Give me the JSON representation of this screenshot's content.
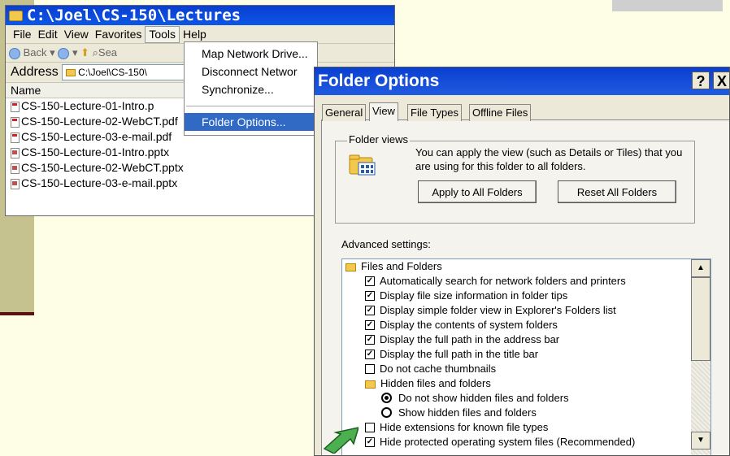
{
  "explorer": {
    "title": "C:\\Joel\\CS-150\\Lectures",
    "menu": [
      "File",
      "Edit",
      "View",
      "Favorites",
      "Tools",
      "Help"
    ],
    "toolbar": {
      "back": "Back",
      "search": "Sea"
    },
    "address_label": "Address",
    "address_value": "C:\\Joel\\CS-150\\",
    "column_name": "Name",
    "files": [
      {
        "name": "CS-150-Lecture-01-Intro.p",
        "type": "pdf"
      },
      {
        "name": "CS-150-Lecture-02-WebCT.pdf",
        "type": "pdf"
      },
      {
        "name": "CS-150-Lecture-03-e-mail.pdf",
        "type": "pdf"
      },
      {
        "name": "CS-150-Lecture-01-Intro.pptx",
        "type": "pptx"
      },
      {
        "name": "CS-150-Lecture-02-WebCT.pptx",
        "type": "pptx"
      },
      {
        "name": "CS-150-Lecture-03-e-mail.pptx",
        "type": "pptx"
      }
    ]
  },
  "tools_menu": {
    "items": [
      "Map Network Drive...",
      "Disconnect Networ",
      "Synchronize...",
      "Folder Options..."
    ]
  },
  "dialog": {
    "title": "Folder Options",
    "help": "?",
    "close": "X",
    "tabs": [
      "General",
      "View",
      "File Types",
      "Offline Files"
    ],
    "folder_views_label": "Folder views",
    "folder_views_text": "You can apply the view (such as Details or Tiles) that you are using for this folder to all folders.",
    "apply_button": "Apply to All Folders",
    "reset_button": "Reset All Folders",
    "advanced_label": "Advanced settings:",
    "settings": [
      {
        "kind": "folder",
        "label": "Files and Folders"
      },
      {
        "kind": "check",
        "checked": true,
        "label": "Automatically search for network folders and printers"
      },
      {
        "kind": "check",
        "checked": true,
        "label": "Display file size information in folder tips"
      },
      {
        "kind": "check",
        "checked": true,
        "label": "Display simple folder view in Explorer's Folders list"
      },
      {
        "kind": "check",
        "checked": true,
        "label": "Display the contents of system folders"
      },
      {
        "kind": "check",
        "checked": true,
        "label": "Display the full path in the address bar"
      },
      {
        "kind": "check",
        "checked": true,
        "label": "Display the full path in the title bar"
      },
      {
        "kind": "check",
        "checked": false,
        "label": "Do not cache thumbnails"
      },
      {
        "kind": "folder",
        "label": "Hidden files and folders"
      },
      {
        "kind": "radio",
        "checked": true,
        "label": "Do not show hidden files and folders"
      },
      {
        "kind": "radio",
        "checked": false,
        "label": "Show hidden files and folders"
      },
      {
        "kind": "check",
        "checked": false,
        "label": "Hide extensions for known file types"
      },
      {
        "kind": "check",
        "checked": true,
        "label": "Hide protected operating system files (Recommended)"
      }
    ]
  },
  "colors": {
    "titlebar": "#0a3fd0",
    "highlight": "#316ac5",
    "slide_background": "#fefde6",
    "slide_accent": "#c6c290",
    "arrow": "#4caf50"
  }
}
